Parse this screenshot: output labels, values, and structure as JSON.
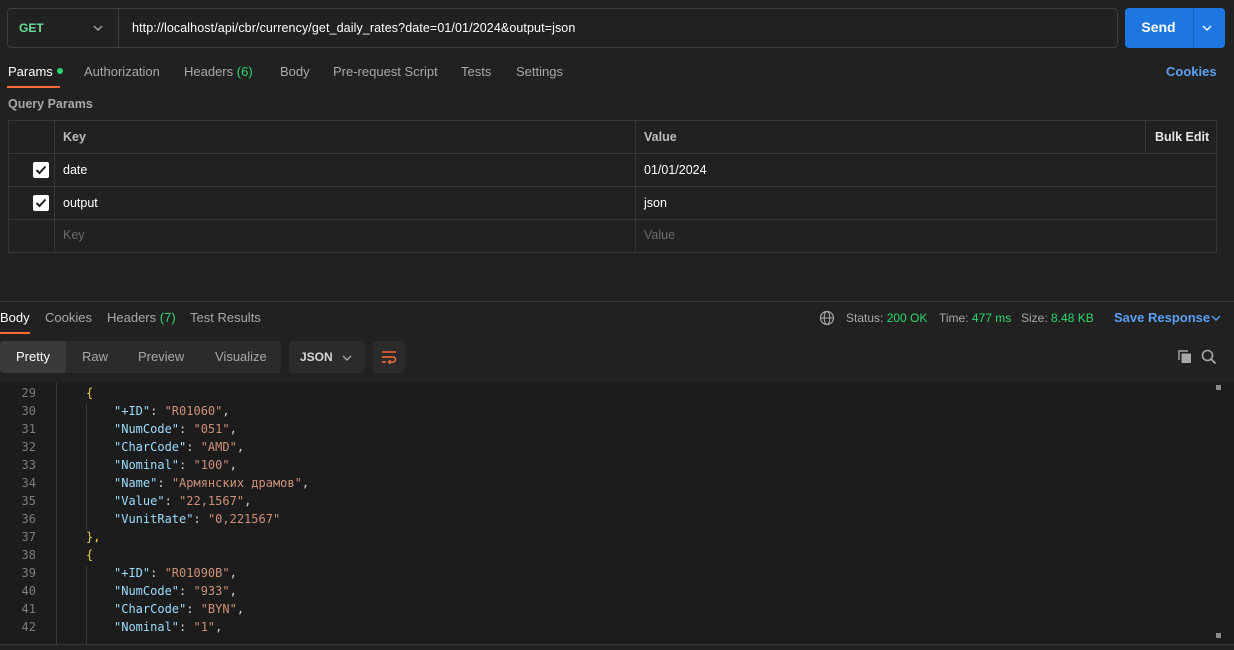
{
  "request": {
    "method": "GET",
    "url": "http://localhost/api/cbr/currency/get_daily_rates?date=01/01/2024&output=json",
    "send_label": "Send"
  },
  "request_tabs": {
    "params": "Params",
    "authorization": "Authorization",
    "headers": "Headers",
    "headers_count": "(6)",
    "body": "Body",
    "pre_request": "Pre-request Script",
    "tests": "Tests",
    "settings": "Settings",
    "cookies": "Cookies"
  },
  "query_params": {
    "title": "Query Params",
    "columns": {
      "key": "Key",
      "value": "Value",
      "bulk_edit": "Bulk Edit"
    },
    "rows": [
      {
        "key": "date",
        "value": "01/01/2024",
        "checked": true
      },
      {
        "key": "output",
        "value": "json",
        "checked": true
      }
    ],
    "placeholder_key": "Key",
    "placeholder_value": "Value"
  },
  "response_tabs": {
    "body": "Body",
    "cookies": "Cookies",
    "headers": "Headers",
    "headers_count": "(7)",
    "test_results": "Test Results"
  },
  "status": {
    "status_label": "Status:",
    "status_value": "200 OK",
    "time_label": "Time:",
    "time_value": "477 ms",
    "size_label": "Size:",
    "size_value": "8.48 KB",
    "save_response": "Save Response"
  },
  "view": {
    "pretty": "Pretty",
    "raw": "Raw",
    "preview": "Preview",
    "visualize": "Visualize",
    "format": "JSON"
  },
  "code_lines": [
    {
      "n": "29",
      "text": "{"
    },
    {
      "n": "30",
      "key": "\"+ID\"",
      "val": "\"R01060\""
    },
    {
      "n": "31",
      "key": "\"NumCode\"",
      "val": "\"051\""
    },
    {
      "n": "32",
      "key": "\"CharCode\"",
      "val": "\"AMD\""
    },
    {
      "n": "33",
      "key": "\"Nominal\"",
      "val": "\"100\""
    },
    {
      "n": "34",
      "key": "\"Name\"",
      "val": "\"Армянских драмов\""
    },
    {
      "n": "35",
      "key": "\"Value\"",
      "val": "\"22,1567\""
    },
    {
      "n": "36",
      "key": "\"VunitRate\"",
      "val": "\"0,221567\"",
      "last": true
    },
    {
      "n": "37",
      "text": "},"
    },
    {
      "n": "38",
      "text": "{"
    },
    {
      "n": "39",
      "key": "\"+ID\"",
      "val": "\"R01090B\""
    },
    {
      "n": "40",
      "key": "\"NumCode\"",
      "val": "\"933\""
    },
    {
      "n": "41",
      "key": "\"CharCode\"",
      "val": "\"BYN\""
    },
    {
      "n": "42",
      "key": "\"Nominal\"",
      "val": "\"1\""
    }
  ],
  "colors": {
    "accent": "#ff6c37",
    "send": "#1e77e0",
    "success": "#2bd76b",
    "link": "#5aa0f2"
  }
}
